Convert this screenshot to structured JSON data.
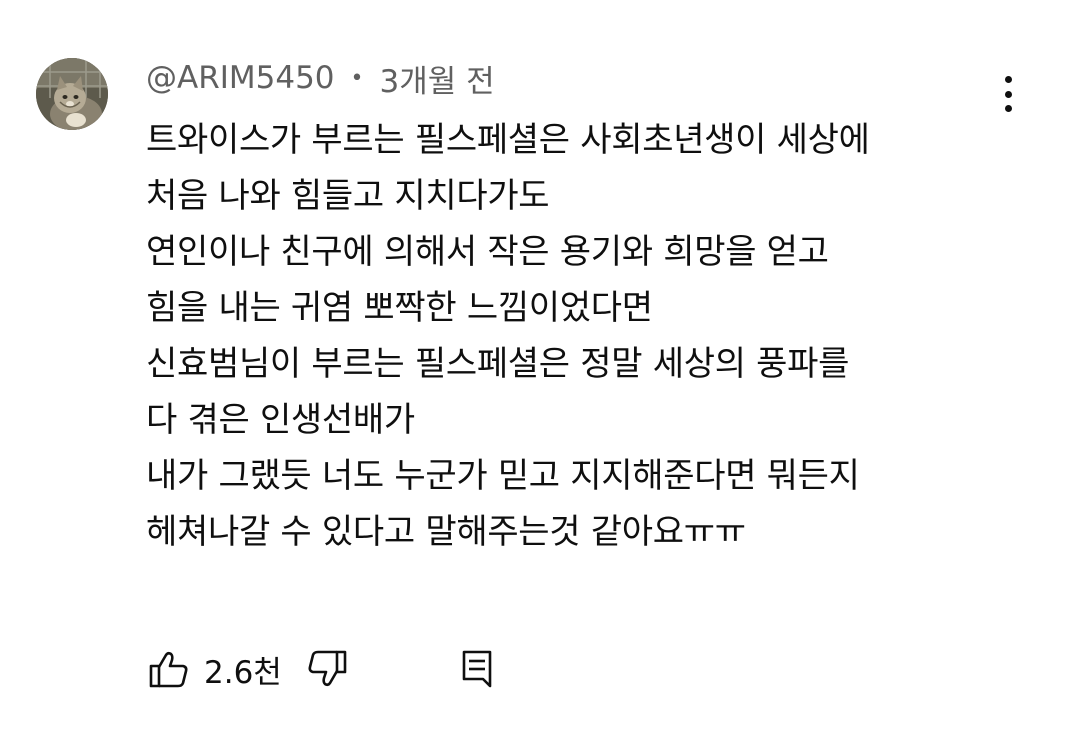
{
  "comment": {
    "author": "@ARIM5450",
    "separator": "•",
    "timestamp": "3개월 전",
    "avatar_icon": "cat-avatar",
    "more_icon": "more-vert-icon",
    "text_lines": [
      "트와이스가 부르는 필스페셜은 사회초년생이 세상에",
      "처음 나와 힘들고 지치다가도",
      "연인이나 친구에 의해서 작은 용기와 희망을 얻고",
      "힘을 내는 귀염 뽀짝한 느낌이었다면",
      "신효범님이 부르는 필스페셜은 정말 세상의 풍파를",
      "다 겪은 인생선배가",
      "내가 그랬듯 너도 누군가 믿고 지지해준다면 뭐든지",
      "헤쳐나갈 수 있다고 말해주는것 같아요ㅠㅠ"
    ],
    "actions": {
      "like_icon": "thumbs-up-icon",
      "like_count": "2.6천",
      "dislike_icon": "thumbs-down-icon",
      "reply_icon": "reply-icon"
    }
  }
}
